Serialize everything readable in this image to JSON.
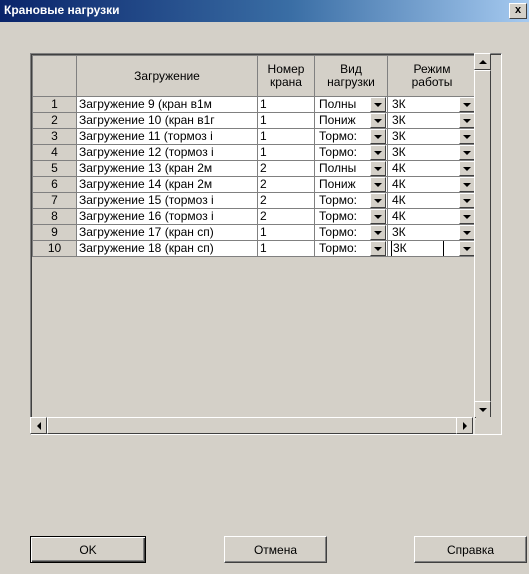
{
  "window": {
    "title": "Крановые нагрузки",
    "close_label": "x"
  },
  "table": {
    "columns": [
      "",
      "Загружение",
      "Номер крана",
      "Вид нагрузки",
      "Режим работы"
    ],
    "column_lines": {
      "number_1": "Номер",
      "number_2": "крана",
      "type_1": "Вид",
      "type_2": "нагрузки",
      "mode_1": "Режим",
      "mode_2": "работы"
    },
    "rows": [
      {
        "n": "1",
        "load": "Загружение  9 (кран в1м",
        "crane": "1",
        "type": "Полны",
        "mode": "3К"
      },
      {
        "n": "2",
        "load": "Загружение  10 (кран в1г",
        "crane": "1",
        "type": "Пониж",
        "mode": "3К"
      },
      {
        "n": "3",
        "load": "Загружение  11 (тормоз і",
        "crane": "1",
        "type": "Тормо:",
        "mode": "3К"
      },
      {
        "n": "4",
        "load": "Загружение  12 (тормоз і",
        "crane": "1",
        "type": "Тормо:",
        "mode": "3К"
      },
      {
        "n": "5",
        "load": "Загружение  13 (кран 2м",
        "crane": "2",
        "type": "Полны",
        "mode": "4К"
      },
      {
        "n": "6",
        "load": "Загружение  14 (кран 2м",
        "crane": "2",
        "type": "Пониж",
        "mode": "4К"
      },
      {
        "n": "7",
        "load": "Загружение  15 (тормоз і",
        "crane": "2",
        "type": "Тормо:",
        "mode": "4К"
      },
      {
        "n": "8",
        "load": "Загружение  16 (тормоз і",
        "crane": "2",
        "type": "Тормо:",
        "mode": "4К"
      },
      {
        "n": "9",
        "load": "Загружение  17 (кран сп)",
        "crane": "1",
        "type": "Тормо:",
        "mode": "3К"
      },
      {
        "n": "10",
        "load": "Загружение  18 (кран сп)",
        "crane": "1",
        "type": "Тормо:",
        "mode": "3К"
      }
    ]
  },
  "buttons": {
    "ok": "OK",
    "cancel": "Отмена",
    "help": "Справка"
  },
  "colors": {
    "titlebar_start": "#0a246a",
    "titlebar_end": "#a6caf0",
    "face": "#d4d0c8"
  },
  "icons": [
    "close-icon",
    "dropdown-arrow-icon",
    "scroll-up-icon",
    "scroll-down-icon",
    "scroll-left-icon",
    "scroll-right-icon"
  ]
}
